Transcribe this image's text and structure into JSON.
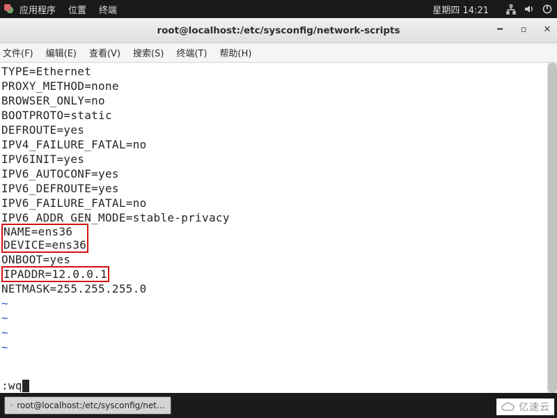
{
  "panel": {
    "apps": "应用程序",
    "places": "位置",
    "terminal": "终端",
    "clock": "星期四 14:21"
  },
  "window": {
    "title": "root@localhost:/etc/sysconfig/network-scripts"
  },
  "menubar": {
    "file": "文件(F)",
    "edit": "编辑(E)",
    "view": "查看(V)",
    "search": "搜索(S)",
    "terminal": "终端(T)",
    "help": "帮助(H)"
  },
  "file_lines": [
    "TYPE=Ethernet",
    "PROXY_METHOD=none",
    "BROWSER_ONLY=no",
    "BOOTPROTO=static",
    "DEFROUTE=yes",
    "IPV4_FAILURE_FATAL=no",
    "IPV6INIT=yes",
    "IPV6_AUTOCONF=yes",
    "IPV6_DEFROUTE=yes",
    "IPV6_FAILURE_FATAL=no",
    "IPV6_ADDR_GEN_MODE=stable-privacy"
  ],
  "highlighted_block1": [
    "NAME=ens36",
    "DEVICE=ens36"
  ],
  "mid_line": "ONBOOT=yes",
  "highlighted_block2": "IPADDR=12.0.0.1",
  "last_line": "NETMASK=255.255.255.0",
  "tilde": "~",
  "command": ":wq",
  "taskbar": {
    "task1": "root@localhost:/etc/sysconfig/net…"
  },
  "watermark": "亿速云"
}
